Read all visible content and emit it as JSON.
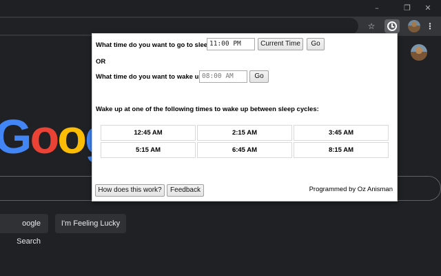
{
  "window": {
    "minimize": "–",
    "restore": "❐",
    "close": "✕"
  },
  "toolbar": {
    "star_icon": "☆",
    "menu_icon": "⋮"
  },
  "google": {
    "logo_letters": [
      "G",
      "o",
      "o",
      "g"
    ],
    "search_button": "oogle Search",
    "lucky_button": "I'm Feeling Lucky"
  },
  "popup": {
    "sleep_question": "What time do you want to go to sleep?",
    "sleep_time_value": "11:00 PM",
    "current_time_button": "Current Time",
    "go_button_1": "Go",
    "or_label": "OR",
    "wake_question": "What time do you want to wake up?",
    "wake_time_value": "08:00 AM",
    "go_button_2": "Go",
    "results_heading": "Wake up at one of the following times to wake up between sleep cycles:",
    "wake_times": [
      "12:45 AM",
      "2:15 AM",
      "3:45 AM",
      "5:15 AM",
      "6:45 AM",
      "8:15 AM"
    ],
    "how_button": "How does this work?",
    "feedback_button": "Feedback",
    "credit": "Programmed by Oz Anisman"
  }
}
